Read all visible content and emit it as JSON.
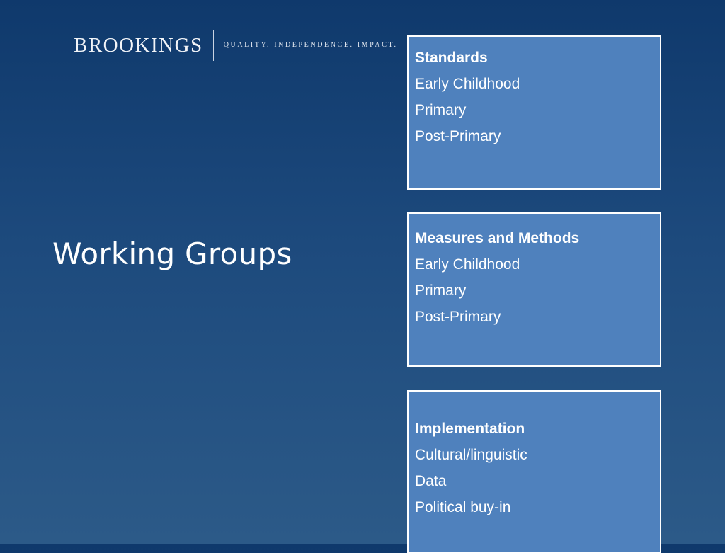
{
  "logo": {
    "wordmark": "BROOKINGS",
    "tagline": "QUALITY. INDEPENDENCE. IMPACT."
  },
  "title": "Working Groups",
  "groups": [
    {
      "heading": "Standards",
      "items": [
        "Early Childhood",
        "Primary",
        "Post-Primary"
      ]
    },
    {
      "heading": "Measures and Methods",
      "items": [
        "Early Childhood",
        "Primary",
        "Post-Primary"
      ]
    },
    {
      "heading": "Implementation",
      "items": [
        "Cultural/linguistic",
        "Data",
        "Political buy-in"
      ]
    }
  ],
  "colors": {
    "background_top": "#0f396c",
    "background_bottom": "#2c5a88",
    "box_fill": "#4f81bd",
    "box_border": "#ffffff",
    "text": "#ffffff"
  }
}
